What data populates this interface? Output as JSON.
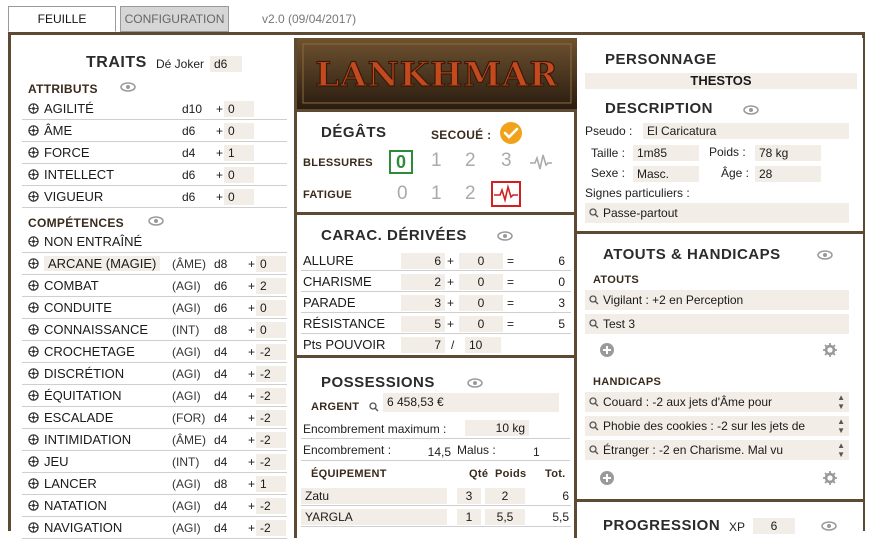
{
  "tabs": {
    "feuille": "FEUILLE",
    "configuration": "CONFIGURATION"
  },
  "version": "v2.0 (09/04/2017)",
  "traits": {
    "title": "TRAITS",
    "joker_label": "Dé Joker",
    "joker_value": "d6",
    "attributs_title": "ATTRIBUTS",
    "attributs": [
      {
        "name": "AGILITÉ",
        "die": "d10",
        "mod": "0"
      },
      {
        "name": "ÂME",
        "die": "d6",
        "mod": "0"
      },
      {
        "name": "FORCE",
        "die": "d4",
        "mod": "1"
      },
      {
        "name": "INTELLECT",
        "die": "d6",
        "mod": "0"
      },
      {
        "name": "VIGUEUR",
        "die": "d6",
        "mod": "0"
      }
    ],
    "competences_title": "COMPÉTENCES",
    "non_entraine": "NON ENTRAÎNÉ",
    "competences": [
      {
        "name": "ARCANE (MAGIE)",
        "attr": "(ÂME)",
        "die": "d8",
        "mod": "0"
      },
      {
        "name": "COMBAT",
        "attr": "(AGI)",
        "die": "d6",
        "mod": "2"
      },
      {
        "name": "CONDUITE",
        "attr": "(AGI)",
        "die": "d6",
        "mod": "0"
      },
      {
        "name": "CONNAISSANCE",
        "attr": "(INT)",
        "die": "d8",
        "mod": "0"
      },
      {
        "name": "CROCHETAGE",
        "attr": "(AGI)",
        "die": "d4",
        "mod": "-2"
      },
      {
        "name": "DISCRÉTION",
        "attr": "(AGI)",
        "die": "d4",
        "mod": "-2"
      },
      {
        "name": "ÉQUITATION",
        "attr": "(AGI)",
        "die": "d4",
        "mod": "-2"
      },
      {
        "name": "ESCALADE",
        "attr": "(FOR)",
        "die": "d4",
        "mod": "-2"
      },
      {
        "name": "INTIMIDATION",
        "attr": "(ÂME)",
        "die": "d4",
        "mod": "-2"
      },
      {
        "name": "JEU",
        "attr": "(INT)",
        "die": "d4",
        "mod": "-2"
      },
      {
        "name": "LANCER",
        "attr": "(AGI)",
        "die": "d8",
        "mod": "1"
      },
      {
        "name": "NATATION",
        "attr": "(AGI)",
        "die": "d4",
        "mod": "-2"
      },
      {
        "name": "NAVIGATION",
        "attr": "(AGI)",
        "die": "d4",
        "mod": "-2"
      }
    ],
    "plus_sign": "+"
  },
  "logo": {
    "text": "LANKHMAR"
  },
  "degats": {
    "title": "DÉGÂTS",
    "secoue_label": "SECOUÉ :",
    "blessures_label": "BLESSURES",
    "blessures": [
      "0",
      "1",
      "2",
      "3"
    ],
    "fatigue_label": "FATIGUE",
    "fatigue": [
      "0",
      "1",
      "2"
    ]
  },
  "carac": {
    "title": "CARAC. DÉRIVÉES",
    "rows": [
      {
        "label": "ALLURE",
        "base": "6",
        "op": "+",
        "mod": "0",
        "eq": "=",
        "total": "6"
      },
      {
        "label": "CHARISME",
        "base": "2",
        "op": "+",
        "mod": "0",
        "eq": "=",
        "total": "0"
      },
      {
        "label": "PARADE",
        "base": "3",
        "op": "+",
        "mod": "0",
        "eq": "=",
        "total": "3"
      },
      {
        "label": "RÉSISTANCE",
        "base": "5",
        "op": "+",
        "mod": "0",
        "eq": "=",
        "total": "5"
      }
    ],
    "pouvoir_label": "Pts POUVOIR",
    "pouvoir_current": "7",
    "pouvoir_sep": "/",
    "pouvoir_max": "10"
  },
  "possessions": {
    "title": "POSSESSIONS",
    "argent_label": "ARGENT",
    "argent_value": "6 458,53 €",
    "enc_max_label": "Encombrement maximum :",
    "enc_max_value": "10 kg",
    "enc_label": "Encombrement :",
    "enc_value": "14,5",
    "malus_label": "Malus :",
    "malus_value": "1",
    "equip_title": "ÉQUIPEMENT",
    "col_qte": "Qté",
    "col_poids": "Poids",
    "col_tot": "Tot.",
    "items": [
      {
        "name": "Zatu",
        "qte": "3",
        "poids": "2",
        "tot": "6"
      },
      {
        "name": "YARGLA",
        "qte": "1",
        "poids": "5,5",
        "tot": "5,5"
      }
    ]
  },
  "personnage": {
    "title": "PERSONNAGE",
    "name": "THESTOS",
    "description_title": "DESCRIPTION",
    "pseudo_label": "Pseudo :",
    "pseudo_value": "El Caricatura",
    "taille_label": "Taille :",
    "taille_value": "1m85",
    "poids_label": "Poids :",
    "poids_value": "78 kg",
    "sexe_label": "Sexe :",
    "sexe_value": "Masc.",
    "age_label": "Âge :",
    "age_value": "28",
    "signes_label": "Signes particuliers :",
    "signes_value": "Passe-partout"
  },
  "atouts": {
    "title": "ATOUTS & HANDICAPS",
    "atouts_title": "ATOUTS",
    "atouts": [
      "Vigilant : +2 en Perception",
      "Test 3"
    ],
    "handicaps_title": "HANDICAPS",
    "handicaps": [
      "Couard : -2 aux jets d'Âme pour",
      "Phobie des cookies : -2 sur les jets de",
      "Étranger : -2 en Charisme. Mal vu"
    ]
  },
  "progression": {
    "title": "PROGRESSION",
    "xp_label": "XP",
    "xp_value": "6"
  },
  "colors": {
    "frame": "#5e4a33",
    "accent_orange": "#f0a31a",
    "wound_green": "#2e8b3a",
    "fatigue_red": "#d21f1f",
    "field_bg": "#f3ede7"
  }
}
